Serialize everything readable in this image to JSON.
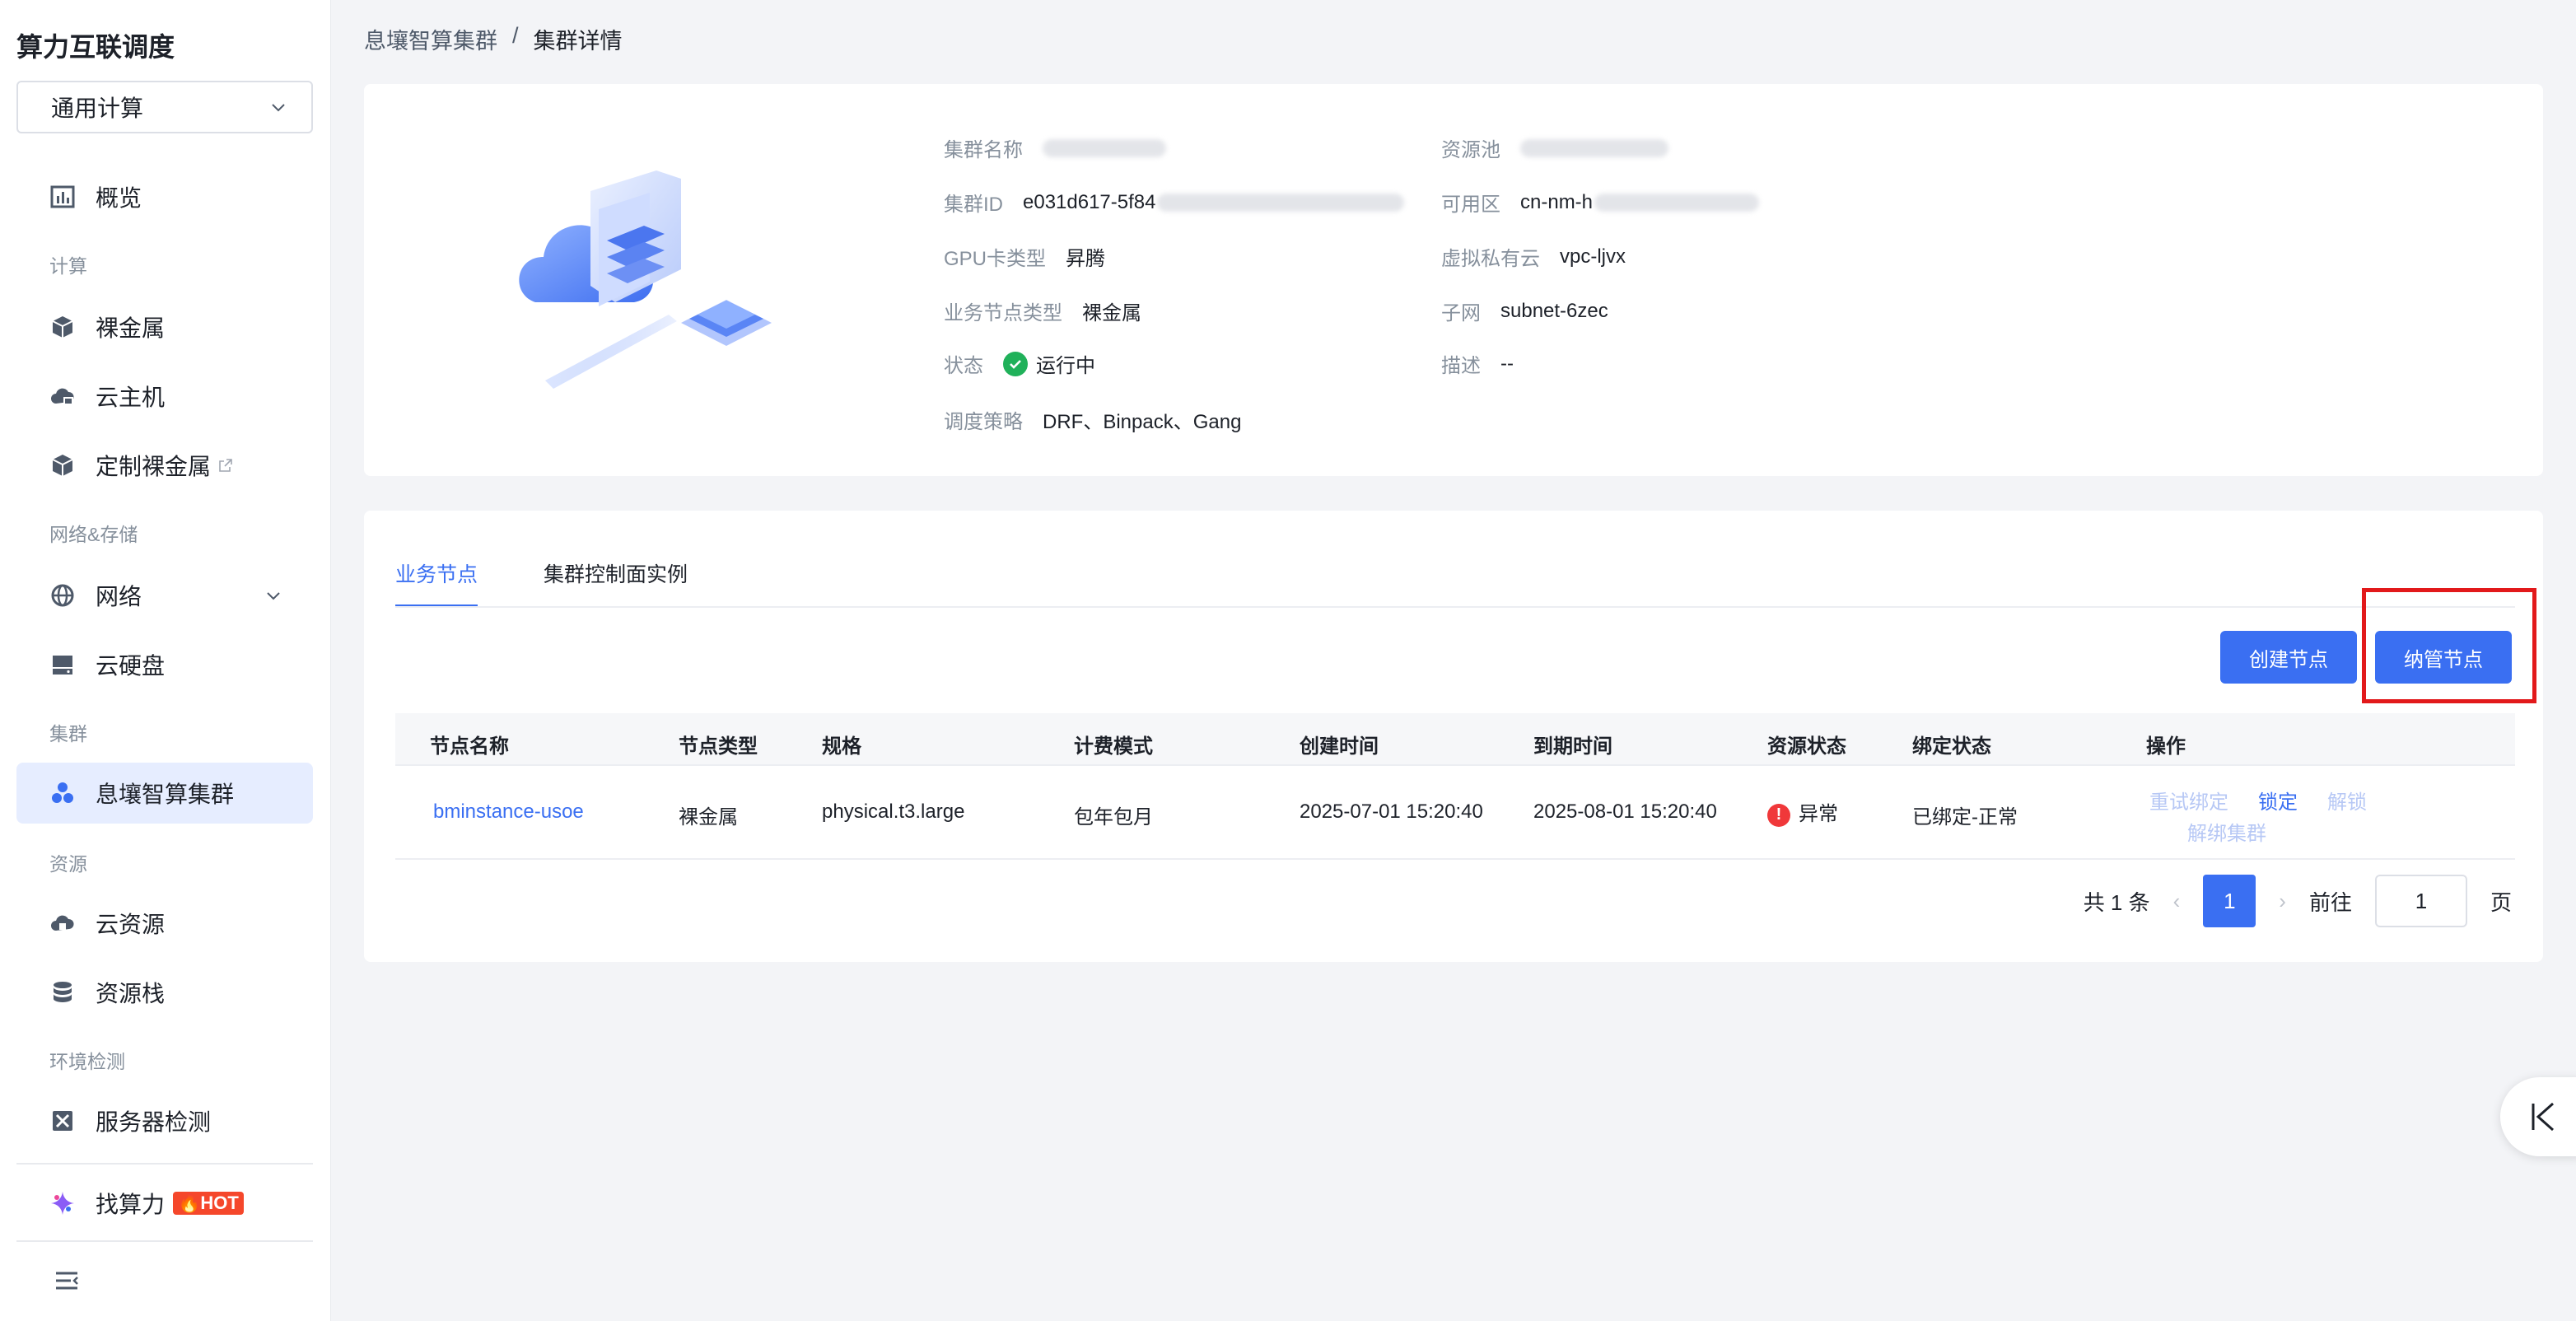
{
  "sidebar": {
    "brand": "算力互联调度",
    "select_value": "通用计算",
    "items": {
      "overview": "概览",
      "group_compute": "计算",
      "baremetal": "裸金属",
      "cloud_host": "云主机",
      "custom_baremetal": "定制裸金属",
      "group_network": "网络&存储",
      "network": "网络",
      "cloud_disk": "云硬盘",
      "group_cluster": "集群",
      "cluster": "息壤智算集群",
      "group_resource": "资源",
      "cloud_resource": "云资源",
      "resource_stack": "资源栈",
      "group_env": "环境检测",
      "server_check": "服务器检测",
      "find_compute": "找算力",
      "hot": "HOT"
    }
  },
  "breadcrumb": {
    "parent": "息壤智算集群",
    "separator": "/",
    "current": "集群详情"
  },
  "cluster_info": {
    "name_label": "集群名称",
    "id_label": "集群ID",
    "id_value": "e031d617-5f84",
    "gpu_label": "GPU卡类型",
    "gpu_value": "昇腾",
    "node_type_label": "业务节点类型",
    "node_type_value": "裸金属",
    "status_label": "状态",
    "status_value": "运行中",
    "strategy_label": "调度策略",
    "strategy_value": "DRF、Binpack、Gang",
    "pool_label": "资源池",
    "zone_label": "可用区",
    "zone_value": "cn-nm-h",
    "vpc_label": "虚拟私有云",
    "vpc_value": "vpc-ljvx",
    "subnet_label": "子网",
    "subnet_value": "subnet-6zec",
    "desc_label": "描述",
    "desc_value": "--"
  },
  "tabs": {
    "business_nodes": "业务节点",
    "control_plane": "集群控制面实例"
  },
  "actions": {
    "create_node": "创建节点",
    "manage_node": "纳管节点"
  },
  "table": {
    "headers": {
      "name": "节点名称",
      "type": "节点类型",
      "spec": "规格",
      "billing": "计费模式",
      "created": "创建时间",
      "expires": "到期时间",
      "resource_status": "资源状态",
      "bind_status": "绑定状态",
      "ops": "操作"
    },
    "rows": [
      {
        "name": "bminstance-usoe",
        "type": "裸金属",
        "spec": "physical.t3.large",
        "billing": "包年包月",
        "created": "2025-07-01 15:20:40",
        "expires": "2025-08-01 15:20:40",
        "resource_status": "异常",
        "bind_status": "已绑定-正常",
        "op_rebind": "重试绑定",
        "op_lock": "锁定",
        "op_unlock": "解锁",
        "op_unbind": "解绑集群"
      }
    ]
  },
  "pager": {
    "total": "共 1 条",
    "page": "1",
    "goto": "前往",
    "goto_value": "1",
    "page_unit": "页"
  },
  "colors": {
    "primary": "#3a6ff2",
    "success": "#20b15a",
    "danger": "#f0383a",
    "highlight": "#e2191b"
  }
}
